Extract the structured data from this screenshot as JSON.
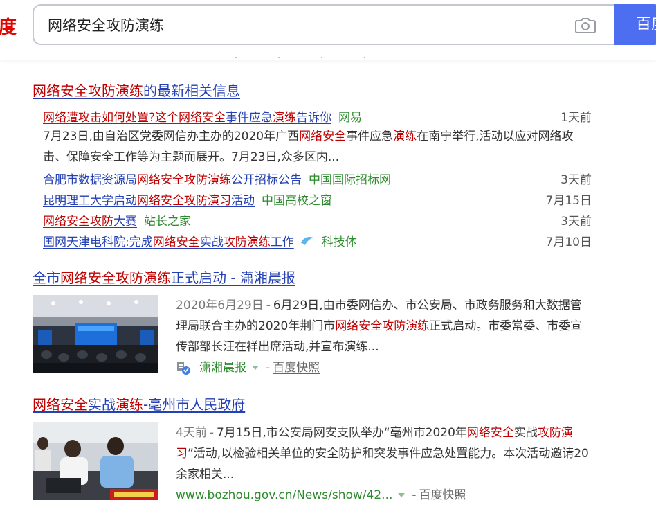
{
  "header": {
    "logo_fragment": "度",
    "search_value": "网络安全攻防演练",
    "search_button_label": "百度一下"
  },
  "news_group": {
    "title_parts": [
      "网络安全攻防演练",
      "的最新相关信息"
    ],
    "items": [
      {
        "title_parts": [
          "网络遭攻击如何处置?这个",
          "网络安全",
          "事件应急",
          "演练",
          "告诉你"
        ],
        "source": "网易",
        "date": "1天前",
        "desc_parts": [
          "7月23日,由自治区党委网信办主办的2020年广西",
          "网络安全",
          "事件应急",
          "演练",
          "在南宁举行,活动以应对网络攻击、保障安全工作等为主题而展开。7月23日,众多区内..."
        ]
      },
      {
        "title_parts": [
          "合肥市数据资源局",
          "网络安全攻防演练",
          "公开招标公告"
        ],
        "source": "中国国际招标网",
        "date": "3天前"
      },
      {
        "title_parts": [
          "昆明理工大学启动",
          "网络安全攻防演习",
          "活动"
        ],
        "source": "中国高校之窗",
        "date": "7月15日"
      },
      {
        "title_parts": [
          "网络安全攻防",
          "大赛"
        ],
        "source": "站长之家",
        "date": "3天前"
      },
      {
        "title_parts": [
          "国网天津电科院:完成",
          "网络安全",
          "实战",
          "攻防演练",
          "工作"
        ],
        "source": "科技体",
        "date": "7月10日"
      }
    ]
  },
  "result2": {
    "title_parts": [
      "全市",
      "网络安全攻防演练",
      "正式启动 - 潇湘晨报"
    ],
    "date": "2020年6月29日",
    "sep": "-",
    "desc_parts": [
      "6月29日,由市委网信办、市公安局、市政务服务和大数据管理局联合主办的2020年荆门市",
      "网络安全攻防演练",
      "正式启动。市委常委、市委宣传部部长汪在祥出席活动,并宣布演练..."
    ],
    "source": "潇湘晨报",
    "cache": "百度快照"
  },
  "result3": {
    "title_parts": [
      "网络安全",
      "实战",
      "演练",
      "-亳州市人民政府"
    ],
    "date": "4天前",
    "sep": "-",
    "desc_parts": [
      "7月15日,市公安局网安支队举办“亳州市2020年",
      "网络安全",
      "实战",
      "攻防演习",
      "”活动,以检验相关单位的安全防护和突发事件应急处置能力。本次活动邀请20余家相关..."
    ],
    "url": "www.bozhou.gov.cn/News/show/42...",
    "cache": "百度快照"
  },
  "colors": {
    "link": "#2440b3",
    "highlight": "#c00000",
    "source_green": "#2d8a2d",
    "button_blue": "#4e6ef2",
    "logo_red": "#e10601"
  }
}
